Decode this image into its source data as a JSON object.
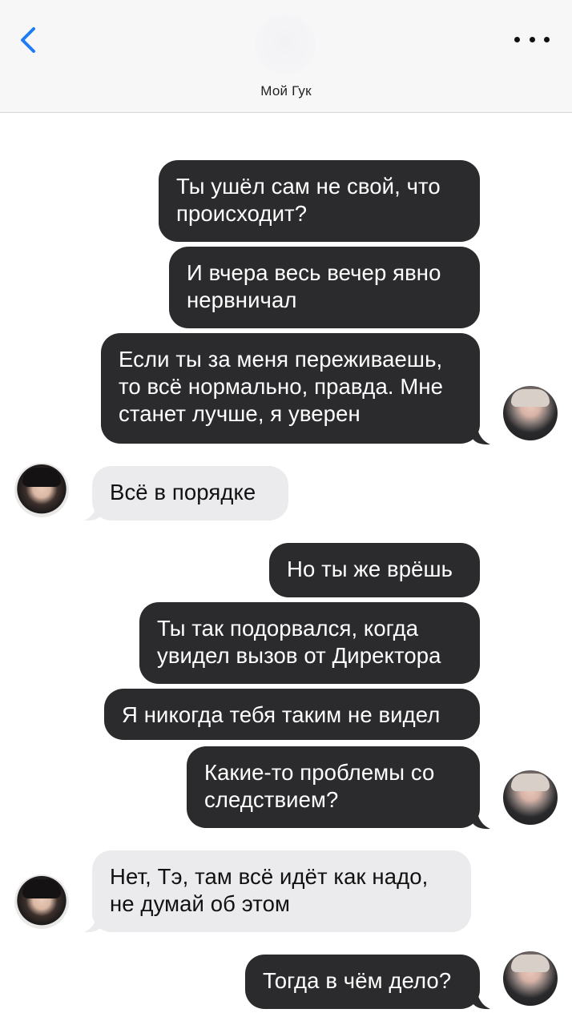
{
  "header": {
    "contact_name": "Мой Гук",
    "back_icon": "chevron-left-icon",
    "more_icon": "more-horizontal-icon",
    "accent": "#1f7cf2"
  },
  "messages": [
    {
      "side": "out",
      "text": "Ты ушёл сам не свой, что происходит?"
    },
    {
      "side": "out",
      "text": "И вчера весь вечер явно нервничал"
    },
    {
      "side": "out",
      "text": "Если ты за меня переживаешь, то всё нормально, правда. Мне станет лучше, я уверен"
    },
    {
      "side": "in",
      "text": "Всё в порядке"
    },
    {
      "side": "out",
      "text": "Но ты же врёшь"
    },
    {
      "side": "out",
      "text": "Ты так подорвался, когда увидел вызов от Директора"
    },
    {
      "side": "out",
      "text": "Я никогда тебя таким не видел"
    },
    {
      "side": "out",
      "text": "Какие-то проблемы со следствием?"
    },
    {
      "side": "in",
      "text": "Нет, Тэ, там всё идёт как надо, не думай об этом"
    },
    {
      "side": "out",
      "text": "Тогда в чём дело?"
    }
  ],
  "colors": {
    "outgoing_bubble": "#2b2b2d",
    "incoming_bubble": "#ebebee",
    "header_bg": "#f7f7f8"
  }
}
